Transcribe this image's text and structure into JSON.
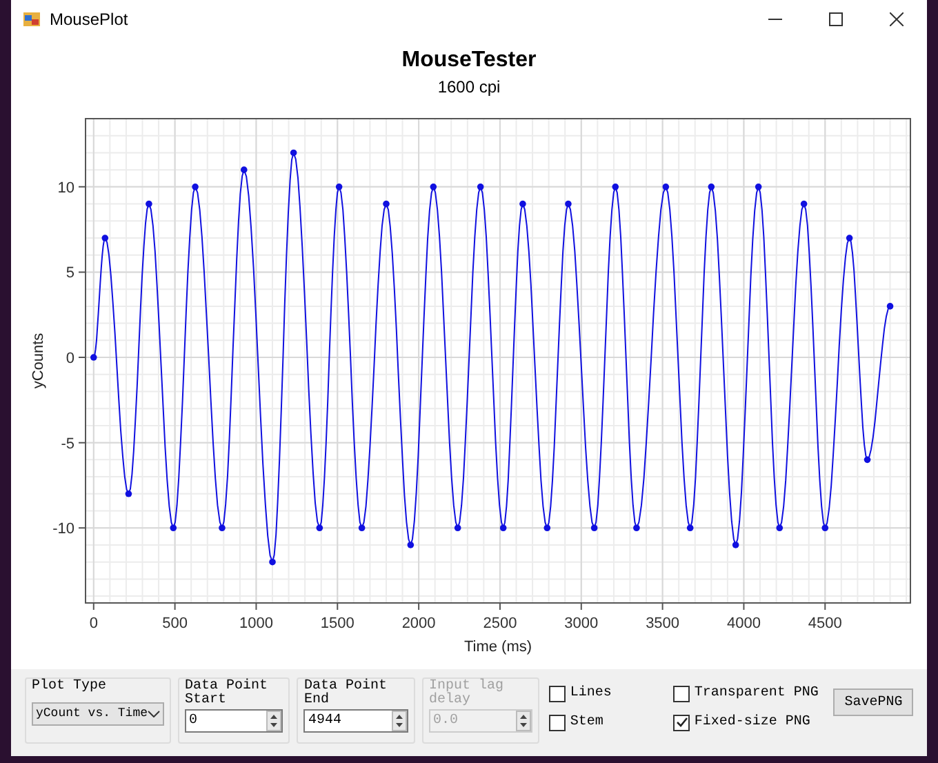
{
  "window": {
    "title": "MousePlot"
  },
  "plot": {
    "title": "MouseTester",
    "subtitle": "1600 cpi",
    "chart_data": {
      "type": "line",
      "xlabel": "Time (ms)",
      "ylabel": "yCounts",
      "x": [
        0,
        70,
        215,
        340,
        490,
        625,
        790,
        925,
        1100,
        1230,
        1390,
        1510,
        1650,
        1800,
        1950,
        2090,
        2240,
        2380,
        2520,
        2640,
        2790,
        2920,
        3080,
        3210,
        3340,
        3520,
        3670,
        3800,
        3950,
        4090,
        4220,
        4370,
        4500,
        4650,
        4760,
        4900
      ],
      "grid": true,
      "series": [
        {
          "color": "#1010e0",
          "marker": "circle",
          "values": [
            0,
            7,
            -8,
            9,
            -10,
            10,
            -10,
            11,
            -12,
            12,
            -10,
            10,
            -10,
            9,
            -11,
            10,
            -10,
            10,
            -10,
            9,
            -10,
            9,
            -10,
            10,
            -10,
            10,
            -10,
            10,
            -11,
            10,
            -10,
            9,
            -10,
            7,
            -6,
            3
          ]
        }
      ],
      "xlim": [
        -50,
        5025
      ],
      "ylim": [
        -14.4,
        14
      ],
      "xticks": [
        0,
        500,
        1000,
        1500,
        2000,
        2500,
        3000,
        3500,
        4000,
        4500
      ],
      "yticks": [
        -10,
        -5,
        0,
        5,
        10
      ]
    }
  },
  "controls": {
    "plot_type": {
      "label": "Plot Type",
      "value": "yCount vs. Time"
    },
    "start": {
      "label": "Data Point Start",
      "value": "0",
      "disabled": false
    },
    "end": {
      "label": "Data Point End",
      "value": "4944",
      "disabled": false
    },
    "lag": {
      "label": "Input lag delay",
      "value": "0.0",
      "disabled": true
    },
    "checkboxes": [
      {
        "label": "Lines",
        "checked": false
      },
      {
        "label": "Stem",
        "checked": false
      }
    ],
    "png_options": [
      {
        "label": "Transparent PNG",
        "checked": false
      },
      {
        "label": "Fixed-size PNG",
        "checked": true
      }
    ],
    "save_button": "SavePNG"
  }
}
